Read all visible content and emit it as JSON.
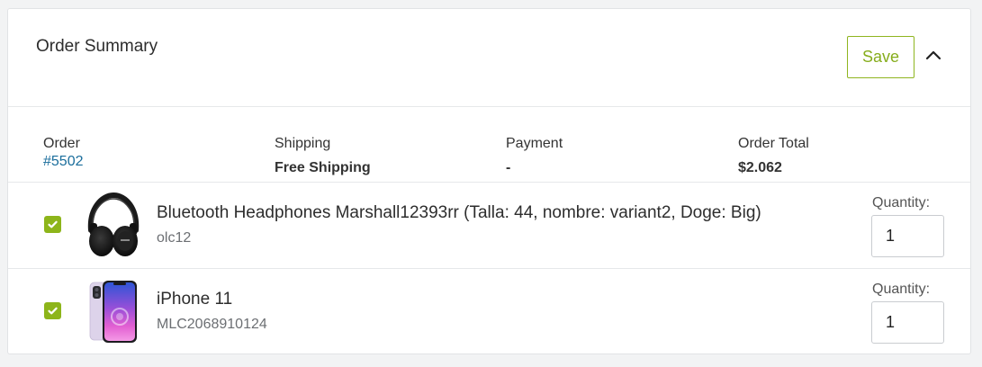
{
  "header": {
    "title": "Order Summary",
    "save_label": "Save"
  },
  "summary": {
    "order_label": "Order",
    "order_value": "#5502",
    "shipping_label": "Shipping",
    "shipping_value": "Free Shipping",
    "payment_label": "Payment",
    "payment_value": "-",
    "total_label": "Order Total",
    "total_value": "$2.062"
  },
  "items": [
    {
      "name": "Bluetooth Headphones Marshall12393rr (Talla: 44, nombre: variant2, Doge: Big)",
      "sku": "olc12",
      "quantity_label": "Quantity:",
      "quantity": "1",
      "checked": true,
      "image_icon": "headphones-image"
    },
    {
      "name": "iPhone 11",
      "sku": "MLC2068910124",
      "quantity_label": "Quantity:",
      "quantity": "1",
      "checked": true,
      "image_icon": "iphone-image"
    }
  ],
  "colors": {
    "accent": "#8db51a",
    "link": "#1b6e9c"
  }
}
